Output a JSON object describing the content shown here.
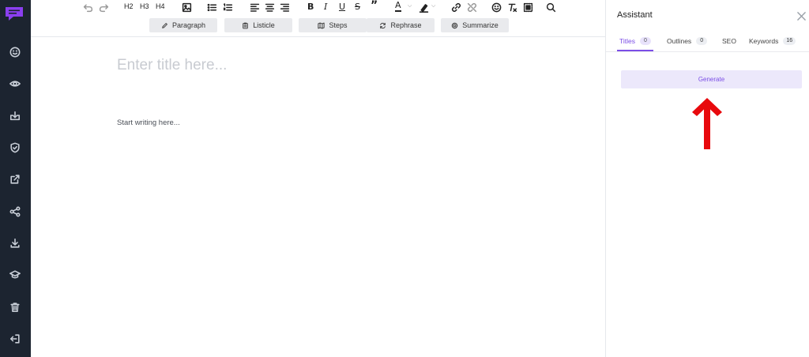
{
  "colors": {
    "rail_bg": "#1c2430",
    "accent": "#7b4ee6",
    "arrow": "#e8090d",
    "logo": "#8b3ff0"
  },
  "rail": {
    "logo": "app-logo",
    "icons": [
      "smile-icon",
      "eye-icon",
      "download-box-icon",
      "shield-check-icon",
      "external-link-icon",
      "share-icon",
      "download-icon",
      "graduation-cap-icon",
      "trash-icon",
      "sign-out-icon"
    ]
  },
  "toolbar": {
    "h2": "H2",
    "h3": "H3",
    "h4": "H4",
    "bold": "B",
    "italic": "I",
    "underline": "U",
    "strike": "S",
    "quote": "”",
    "text_color": "A",
    "ai_buttons": {
      "paragraph": "Paragraph",
      "listicle": "Listicle",
      "steps": "Steps",
      "rephrase": "Rephrase",
      "summarize": "Summarize"
    }
  },
  "editor": {
    "title_placeholder": "Enter title here...",
    "body_placeholder": "Start writing here..."
  },
  "assistant": {
    "title": "Assistant",
    "tabs": {
      "titles": {
        "label": "Titles",
        "count": "0"
      },
      "outlines": {
        "label": "Outlines",
        "count": "0"
      },
      "seo": {
        "label": "SEO"
      },
      "keywords": {
        "label": "Keywords",
        "count": "16"
      }
    },
    "generate_label": "Generate"
  }
}
